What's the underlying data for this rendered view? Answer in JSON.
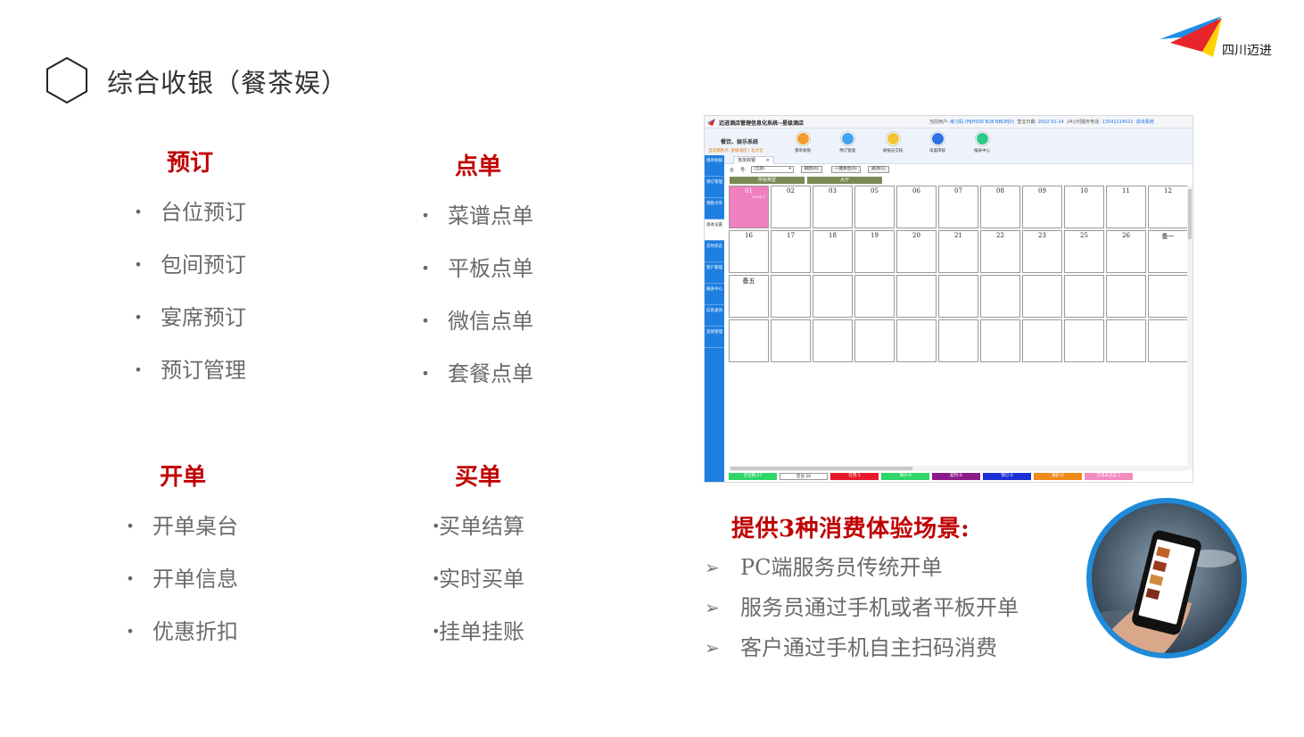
{
  "header": {
    "title": "综合收银（餐茶娱）",
    "logo_text": "四川迈进"
  },
  "sections": [
    {
      "heading": "预订",
      "items": [
        "台位预订",
        "包间预订",
        "宴席预订",
        "预订管理"
      ]
    },
    {
      "heading": "点单",
      "items": [
        "菜谱点单",
        "平板点单",
        "微信点单",
        "套餐点单"
      ]
    },
    {
      "heading": "开单",
      "items": [
        "开单桌台",
        "开单信息",
        "优惠折扣"
      ]
    },
    {
      "heading": "买单",
      "items": [
        "买单结算",
        "实时买单",
        "挂单挂账"
      ]
    }
  ],
  "screenshot": {
    "app_title": "迈进酒店管理信息化系统--星级酒店",
    "status_user_label": "当前用户:",
    "status_user": "练习码",
    "status_code": "(MJHS00 B28 NBDPJD)",
    "status_date_label": "营业日期:",
    "status_date": "2022-01-14",
    "status_phone_label": "24小时服务电话:",
    "status_phone": "13541114521",
    "status_exit": "退出系统",
    "system_name": "餐饮、娱乐系统",
    "sub_line": "当前销售点: 星级酒店 | 北大堂",
    "tab": "落单收银",
    "toolbar": [
      {
        "label": "落单收银",
        "color": "#f39c32"
      },
      {
        "label": "预订管理",
        "color": "#3fa3f0"
      },
      {
        "label": "收银员交班",
        "color": "#f3c431"
      },
      {
        "label": "早晨审核",
        "color": "#2a73e4"
      },
      {
        "label": "报表中心",
        "color": "#2cc989"
      }
    ],
    "sidebar": [
      "落单收银",
      "预订管理",
      "销售点单",
      "基本设置",
      "实时状态",
      "客户管理",
      "报表中心",
      "信息查询",
      "其他管理"
    ],
    "filter": {
      "label1": "台",
      "label2": "号:",
      "select": "(全部)",
      "btn_refresh": "刷新(R)",
      "btn_clear": "一键关台(A)",
      "btn_close": "关闭(C)"
    },
    "type_tabs": [
      "所有类型",
      "大厅"
    ],
    "tables": [
      "01",
      "02",
      "03",
      "05",
      "06",
      "07",
      "08",
      "09",
      "10",
      "11",
      "12",
      "16",
      "17",
      "18",
      "19",
      "20",
      "21",
      "22",
      "23",
      "25",
      "26",
      "备一",
      "备五"
    ],
    "occupied_note": "28.00 1",
    "legend": [
      {
        "label": "空台数:27",
        "color": "#2ed66a"
      },
      {
        "label": "空台:26",
        "color": "#ffffff"
      },
      {
        "label": "在用:1",
        "color": "#e8192c"
      },
      {
        "label": "清扫:0",
        "color": "#2ed66a"
      },
      {
        "label": "超时:0",
        "color": "#8b1a8b"
      },
      {
        "label": "预订:0",
        "color": "#1b2fd6"
      },
      {
        "label": "维护:0",
        "color": "#f08a1a"
      },
      {
        "label": "在用未点菜:1",
        "color": "#f28ac0"
      }
    ]
  },
  "scenarios": {
    "title": "提供3种消费体验场景:",
    "items": [
      "PC端服务员传统开单",
      "服务员通过手机或者平板开单",
      "客户通过手机自主扫码消费"
    ]
  }
}
